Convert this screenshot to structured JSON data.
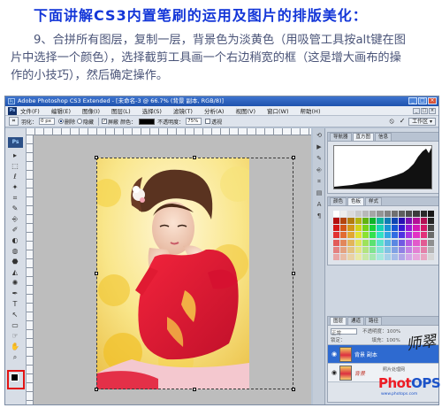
{
  "tutorial": {
    "title": "下面讲解CS3内置笔刷的运用及图片的排版美化：",
    "line1": "9、合拼所有图层，复制一层，背景色为淡黄色（用吸管工具按alt键在图",
    "line2": "片中选择一个颜色），选择截剪工具画一个右边稍宽的框（这是增大画布的操",
    "line3": "作的小技巧），然后确定操作。"
  },
  "app": {
    "title": "Adobe Photoshop CS3 Extended - [未命名-3 @ 66.7% (背景 副本, RGB/8)]",
    "logo": "Ps",
    "window_buttons": [
      "_",
      "□",
      "×"
    ]
  },
  "menu": [
    "文件(F)",
    "编辑(E)",
    "图像(I)",
    "图层(L)",
    "选择(S)",
    "滤镜(T)",
    "分析(A)",
    "视图(V)",
    "窗口(W)",
    "帮助(H)"
  ],
  "options_bar": {
    "label_feather": "羽化：",
    "feather_value": "0 px",
    "label_delete": "删除",
    "label_hide": "隐藏",
    "label_shield": "屏蔽",
    "label_color": "颜色：",
    "label_opacity": "不透明度：",
    "opacity_value": "75%",
    "label_perspective": "透视",
    "workspace": "工作区 ▾",
    "cancel_icon": "⦸",
    "commit_icon": "✓"
  },
  "toolbox": {
    "logo": "Ps",
    "tools": [
      "▸",
      "⬚",
      "ℓ",
      "✦",
      "⌗",
      "✎",
      "⎆",
      "✐",
      "◐",
      "◍",
      "⬣",
      "◭",
      "✺",
      "✒",
      "T",
      "↖",
      "▭",
      "☞",
      "✋",
      "⌕"
    ]
  },
  "panels": {
    "top_tabs": [
      "导航器",
      "直方图",
      "信息"
    ],
    "swatch_tabs": [
      "颜色",
      "色板",
      "样式"
    ],
    "layers_tabs": [
      "图层",
      "通道",
      "路径"
    ],
    "blend_mode": "正常",
    "opacity_label": "不透明度：100%",
    "lock_label": "锁定：",
    "fill_label": "填充：100%",
    "layers": [
      {
        "name": "背景 副本",
        "selected": true
      },
      {
        "name": "背景",
        "selected": false
      }
    ]
  },
  "watermark": {
    "script": "师翠",
    "caption": "照片处理网",
    "logo_a": "Phot",
    "logo_b": "OPS",
    "site": "www.photops.com"
  },
  "colors": {
    "title_blue": "#1336d8",
    "selected_layer": "#2e6ad0",
    "highlight_red": "#e21313"
  }
}
